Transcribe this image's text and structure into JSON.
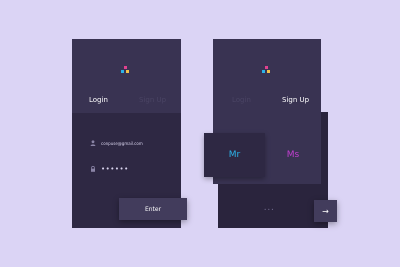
{
  "login_card": {
    "tabs": {
      "login": "Login",
      "signup": "Sign Up"
    },
    "email_value": "conpuse@gmail.com",
    "password_value": "••••••",
    "enter_label": "Enter"
  },
  "signup_card": {
    "tabs": {
      "login": "Login",
      "signup": "Sign Up"
    },
    "options": {
      "mr": "Mr",
      "ms": "Ms"
    },
    "progress_dots": "•  •  •",
    "next_arrow": "→"
  },
  "colors": {
    "background": "#dbd4f5",
    "card": "#2e2843",
    "card_top": "#393352",
    "mr": "#2bb3ea",
    "ms": "#c23ed0",
    "logo_blue": "#2bb3ea",
    "logo_pink": "#e0418f",
    "logo_yellow": "#f2c14b"
  }
}
